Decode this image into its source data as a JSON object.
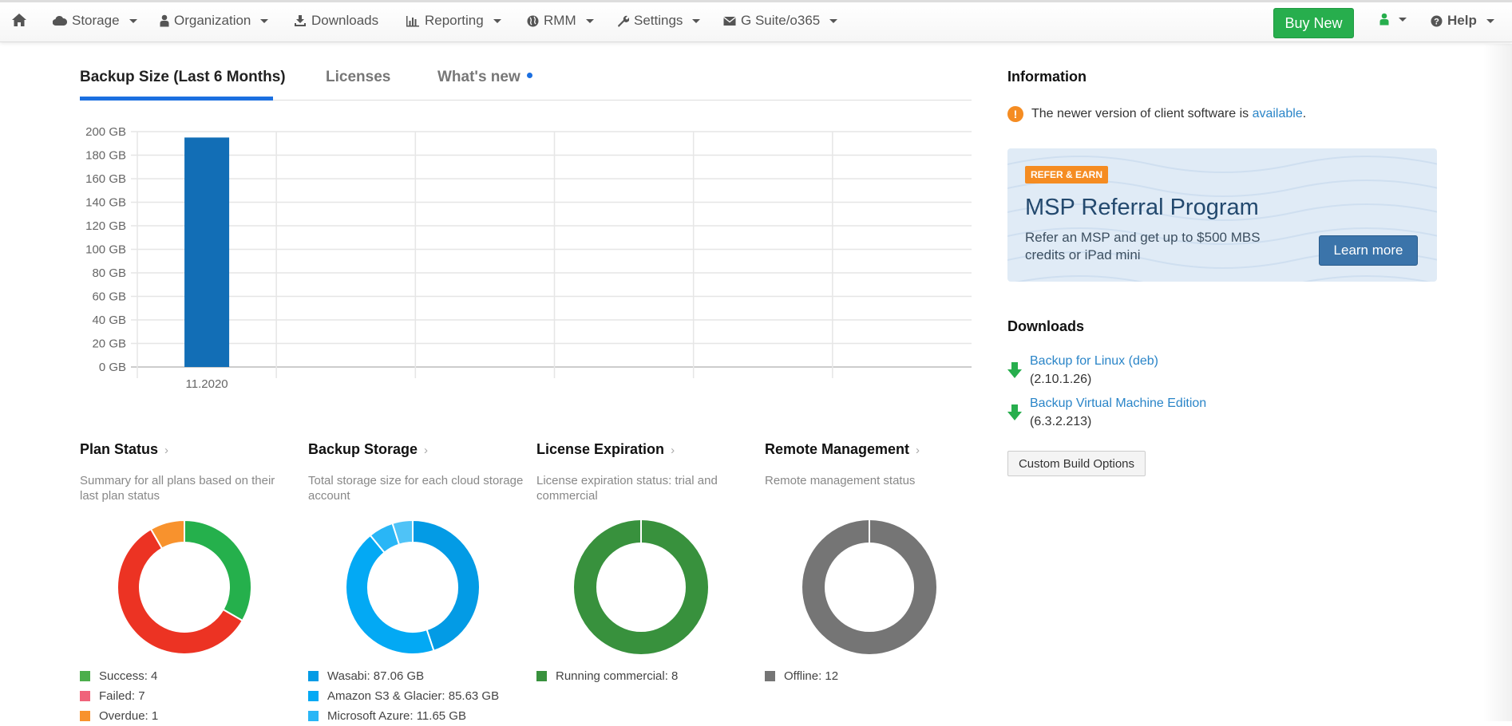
{
  "navbar": {
    "items": [
      {
        "label": "Storage",
        "icon": "cloud-icon",
        "dropdown": true
      },
      {
        "label": "Organization",
        "icon": "user-icon",
        "dropdown": true
      },
      {
        "label": "Downloads",
        "icon": "download-icon",
        "dropdown": false
      },
      {
        "label": "Reporting",
        "icon": "bar-chart-icon",
        "dropdown": true
      },
      {
        "label": "RMM",
        "icon": "globe-icon",
        "dropdown": true
      },
      {
        "label": "Settings",
        "icon": "wrench-icon",
        "dropdown": true
      },
      {
        "label": "G Suite/o365",
        "icon": "envelope-icon",
        "dropdown": true
      }
    ],
    "buy_new_label": "Buy New",
    "help_label": "Help"
  },
  "tabs": [
    {
      "label": "Backup Size (Last 6 Months)",
      "active": true
    },
    {
      "label": "Licenses",
      "active": false
    },
    {
      "label": "What's new",
      "active": false,
      "has_dot": true
    }
  ],
  "chart_data": {
    "type": "bar",
    "title": "Backup Size (Last 6 Months)",
    "categories": [
      "11.2020",
      "",
      "",
      "",
      "",
      ""
    ],
    "values": [
      195,
      0,
      0,
      0,
      0,
      0
    ],
    "xlabel": "",
    "ylabel": "",
    "ylim": [
      0,
      200
    ],
    "yticks": [
      "200 GB",
      "180 GB",
      "160 GB",
      "140 GB",
      "120 GB",
      "100 GB",
      "80 GB",
      "60 GB",
      "40 GB",
      "20 GB",
      "0 GB"
    ],
    "grid": true,
    "bar_color": "#126eb6"
  },
  "widgets": [
    {
      "title": "Plan Status",
      "desc": "Summary for all plans based on their last plan status",
      "slices": [
        {
          "label": "Success: 4",
          "value": 4,
          "color": "#25b04c",
          "swatch": "#4cae4c"
        },
        {
          "label": "Failed: 7",
          "value": 7,
          "color": "#ec3323",
          "swatch": "#f0637a"
        },
        {
          "label": "Overdue: 1",
          "value": 1,
          "color": "#f8922d",
          "swatch": "#f8922d"
        }
      ]
    },
    {
      "title": "Backup Storage",
      "desc": "Total storage size for each cloud storage account",
      "slices": [
        {
          "label": "Wasabi: 87.06 GB",
          "value": 87.06,
          "color": "#039be5",
          "swatch": "#039be5"
        },
        {
          "label": "Amazon S3 & Glacier: 85.63 GB",
          "value": 85.63,
          "color": "#03a9f4",
          "swatch": "#03a9f4"
        },
        {
          "label": "Microsoft Azure: 11.65 GB",
          "value": 11.65,
          "color": "#29b6f6",
          "swatch": "#29b6f6"
        },
        {
          "label": "",
          "value": 9.5,
          "color": "#4fc3f7",
          "swatch": "#4fc3f7"
        }
      ]
    },
    {
      "title": "License Expiration",
      "desc": "License expiration status: trial and commercial",
      "slices": [
        {
          "label": "Running commercial: 8",
          "value": 8,
          "color": "#38913d",
          "swatch": "#38913d"
        }
      ]
    },
    {
      "title": "Remote Management",
      "desc": "Remote management status",
      "slices": [
        {
          "label": "Offline: 12",
          "value": 12,
          "color": "#757575",
          "swatch": "#757575"
        }
      ]
    }
  ],
  "information": {
    "title": "Information",
    "notice_text": "The newer version of client software is",
    "notice_link": "available",
    "notice_suffix": "."
  },
  "promo": {
    "badge": "REFER & EARN",
    "title": "MSP Referral Program",
    "text": "Refer an MSP and get up to $500 MBS credits or iPad mini",
    "button": "Learn more"
  },
  "downloads": {
    "title": "Downloads",
    "items": [
      {
        "name": "Backup for Linux (deb)",
        "version": "(2.10.1.26)"
      },
      {
        "name": "Backup Virtual Machine Edition",
        "version": "(6.3.2.213)"
      }
    ],
    "custom_button": "Custom Build Options"
  }
}
